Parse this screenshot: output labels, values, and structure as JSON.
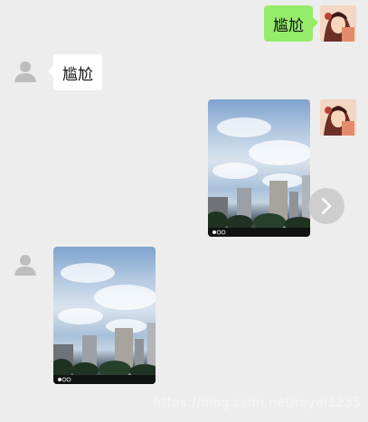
{
  "messages": [
    {
      "side": "sent",
      "type": "text",
      "text": "尴尬"
    },
    {
      "side": "received",
      "type": "text",
      "text": "尴尬"
    },
    {
      "side": "sent",
      "type": "image"
    },
    {
      "side": "received",
      "type": "image"
    }
  ],
  "colors": {
    "background": "#ededed",
    "sent_bubble": "#95ec69",
    "received_bubble": "#ffffff",
    "default_avatar": "#bdbdbd"
  },
  "footer": {
    "url": "https://blog.csdn.net/royal1235"
  },
  "icons": {
    "peer_avatar": "default-person-icon",
    "forward": "chevron-right-icon"
  }
}
